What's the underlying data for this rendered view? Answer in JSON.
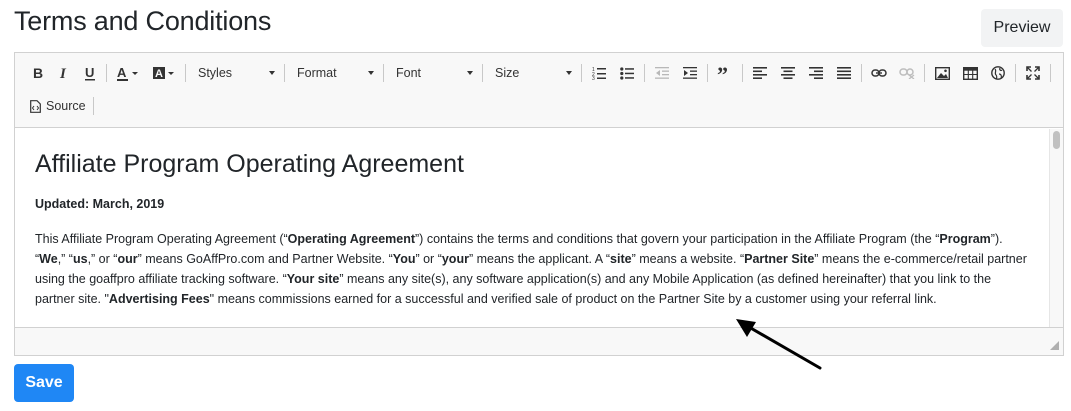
{
  "page": {
    "title": "Terms and Conditions",
    "preview_label": "Preview",
    "save_label": "Save"
  },
  "toolbar": {
    "buttons_row1": [
      {
        "name": "bold",
        "icon": "bold-icon"
      },
      {
        "name": "italic",
        "icon": "italic-icon"
      },
      {
        "name": "underline",
        "icon": "underline-icon"
      },
      {
        "name": "text-color",
        "icon": "text-color-icon"
      },
      {
        "name": "background-color",
        "icon": "background-color-icon"
      }
    ],
    "styles_label": "Styles",
    "format_label": "Format",
    "font_label": "Font",
    "size_label": "Size",
    "buttons_after_combos": [
      {
        "name": "numbered-list",
        "icon": "numbered-list-icon"
      },
      {
        "name": "bulleted-list",
        "icon": "bulleted-list-icon"
      },
      {
        "name": "outdent",
        "icon": "outdent-icon",
        "disabled": true
      },
      {
        "name": "indent",
        "icon": "indent-icon"
      },
      {
        "name": "blockquote",
        "icon": "blockquote-icon"
      },
      {
        "name": "align-left",
        "icon": "align-left-icon"
      },
      {
        "name": "align-center",
        "icon": "align-center-icon"
      },
      {
        "name": "align-right",
        "icon": "align-right-icon"
      },
      {
        "name": "justify",
        "icon": "justify-icon"
      },
      {
        "name": "link",
        "icon": "link-icon"
      },
      {
        "name": "unlink",
        "icon": "unlink-icon",
        "disabled": true
      },
      {
        "name": "image",
        "icon": "image-icon"
      },
      {
        "name": "table",
        "icon": "table-icon"
      },
      {
        "name": "iframe",
        "icon": "globe-icon"
      },
      {
        "name": "maximize",
        "icon": "maximize-icon"
      }
    ],
    "source_label": "Source"
  },
  "document": {
    "heading": "Affiliate Program Operating Agreement",
    "updated": "Updated: March, 2019",
    "paragraph": [
      {
        "t": "This Affiliate Program Operating Agreement (“",
        "b": false
      },
      {
        "t": "Operating Agreement",
        "b": true
      },
      {
        "t": "”) contains the terms and conditions that govern your participation in the Affiliate Program (the “",
        "b": false
      },
      {
        "t": "Program",
        "b": true
      },
      {
        "t": "”). “",
        "b": false
      },
      {
        "t": "We",
        "b": true
      },
      {
        "t": ",” “",
        "b": false
      },
      {
        "t": "us",
        "b": true
      },
      {
        "t": ",” or “",
        "b": false
      },
      {
        "t": "our",
        "b": true
      },
      {
        "t": "” means GoAffPro.com and Partner Website. “",
        "b": false
      },
      {
        "t": "You",
        "b": true
      },
      {
        "t": "” or “",
        "b": false
      },
      {
        "t": "your",
        "b": true
      },
      {
        "t": "” means the applicant. A “",
        "b": false
      },
      {
        "t": "site",
        "b": true
      },
      {
        "t": "” means a website. “",
        "b": false
      },
      {
        "t": "Partner Site",
        "b": true
      },
      {
        "t": "” means the e-commerce/retail partner using the goaffpro affiliate tracking software. “",
        "b": false
      },
      {
        "t": "Your site",
        "b": true
      },
      {
        "t": "” means any site(s), any software application(s) and any Mobile Application (as defined hereinafter) that you link to the partner site. \"",
        "b": false
      },
      {
        "t": "Advertising Fees",
        "b": true
      },
      {
        "t": "\" means commissions earned for a successful and verified sale of product on the Partner Site by a customer using your referral link.",
        "b": false
      }
    ]
  },
  "colors": {
    "accent": "#1f87f5",
    "toolbar_bg": "#f8f8f8",
    "border": "#d1d1d1",
    "text": "#212529"
  }
}
